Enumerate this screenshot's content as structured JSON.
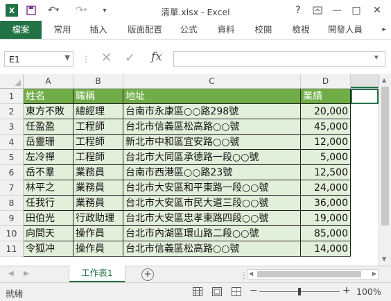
{
  "window": {
    "title": "清單.xlsx - Excel",
    "app_icon_label": "X",
    "controls": [
      "?",
      "—",
      "□",
      "✕"
    ]
  },
  "ribbon": {
    "tabs": [
      "檔案",
      "常用",
      "插入",
      "版面配置",
      "公式",
      "資料",
      "校閱",
      "檢視",
      "開發人員"
    ],
    "accent": "#217346"
  },
  "formula_bar": {
    "name_box": "E1",
    "formula": "",
    "fx_label": "fx"
  },
  "sheet": {
    "columns": [
      "A",
      "B",
      "C",
      "D"
    ],
    "rows": [
      "1",
      "2",
      "3",
      "4",
      "5",
      "6",
      "7",
      "8",
      "9",
      "10",
      "11"
    ],
    "header": [
      "姓名",
      "職稱",
      "地址",
      "業績"
    ],
    "data": [
      [
        "東方不敗",
        "總經理",
        "台南市永康區○○路298號",
        "20,000"
      ],
      [
        "任盈盈",
        "工程師",
        "台北市信義區松高路○○號",
        "45,000"
      ],
      [
        "岳靈珊",
        "工程師",
        "新北市中和區宜安路○○號",
        "12,000"
      ],
      [
        "左冷禪",
        "工程師",
        "台北市大同區承德路一段○○號",
        "5,000"
      ],
      [
        "岳不羣",
        "業務員",
        "台南市西港區○○路23號",
        "12,500"
      ],
      [
        "林平之",
        "業務員",
        "台北市大安區和平東路一段○○號",
        "24,000"
      ],
      [
        "任我行",
        "業務員",
        "台北市大安區市民大道三段○○號",
        "36,000"
      ],
      [
        "田伯光",
        "行政助理",
        "台北市大安區忠孝東路四段○○號",
        "19,000"
      ],
      [
        "向問天",
        "操作員",
        "台北市內湖區環山路二段○○號",
        "85,000"
      ],
      [
        "令狐冲",
        "操作員",
        "台北市信義區松高路○○號",
        "14,000"
      ]
    ],
    "header_color": "#70ad47",
    "row_color": "#e2efda"
  },
  "sheet_tabs": {
    "active": "工作表1",
    "add_label": "+"
  },
  "status": {
    "ready": "就緒",
    "zoom": "100%",
    "zoom_minus": "−",
    "zoom_plus": "+"
  }
}
